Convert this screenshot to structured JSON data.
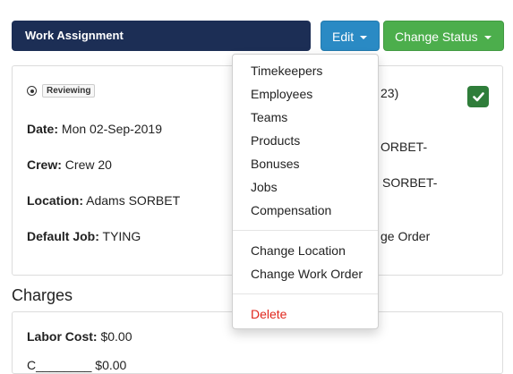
{
  "header": {
    "title": "Work Assignment",
    "edit_label": "Edit",
    "status_label": "Change Status"
  },
  "detail": {
    "status_badge": "Reviewing",
    "date_label": "Date:",
    "date_value": "Mon 02-Sep-2019",
    "crew_label": "Crew:",
    "crew_value": "Crew 20",
    "location_label": "Location:",
    "location_value": "Adams SORBET",
    "default_job_label": "Default Job:",
    "default_job_value": "TYING",
    "right_frag_1": "23)",
    "right_frag_2": "ORBET-",
    "right_frag_3": "SORBET-",
    "right_frag_4": "ge Order"
  },
  "charges": {
    "title": "Charges",
    "labor_label": "Labor Cost:",
    "labor_value": "$0.00",
    "partial_line": "C________ $0.00"
  },
  "edit_menu": {
    "items": [
      "Timekeepers",
      "Employees",
      "Teams",
      "Products",
      "Bonuses",
      "Jobs",
      "Compensation"
    ],
    "change_location": "Change Location",
    "change_work_order": "Change Work Order",
    "delete": "Delete"
  },
  "colors": {
    "header_bg": "#1c2e55",
    "edit_bg": "#2a8ac4",
    "status_bg": "#4cae4c",
    "danger": "#e0261b",
    "check_bg": "#2f7d3a"
  },
  "icons": [
    "radio-icon",
    "caret-down-icon",
    "checkmark-icon"
  ]
}
